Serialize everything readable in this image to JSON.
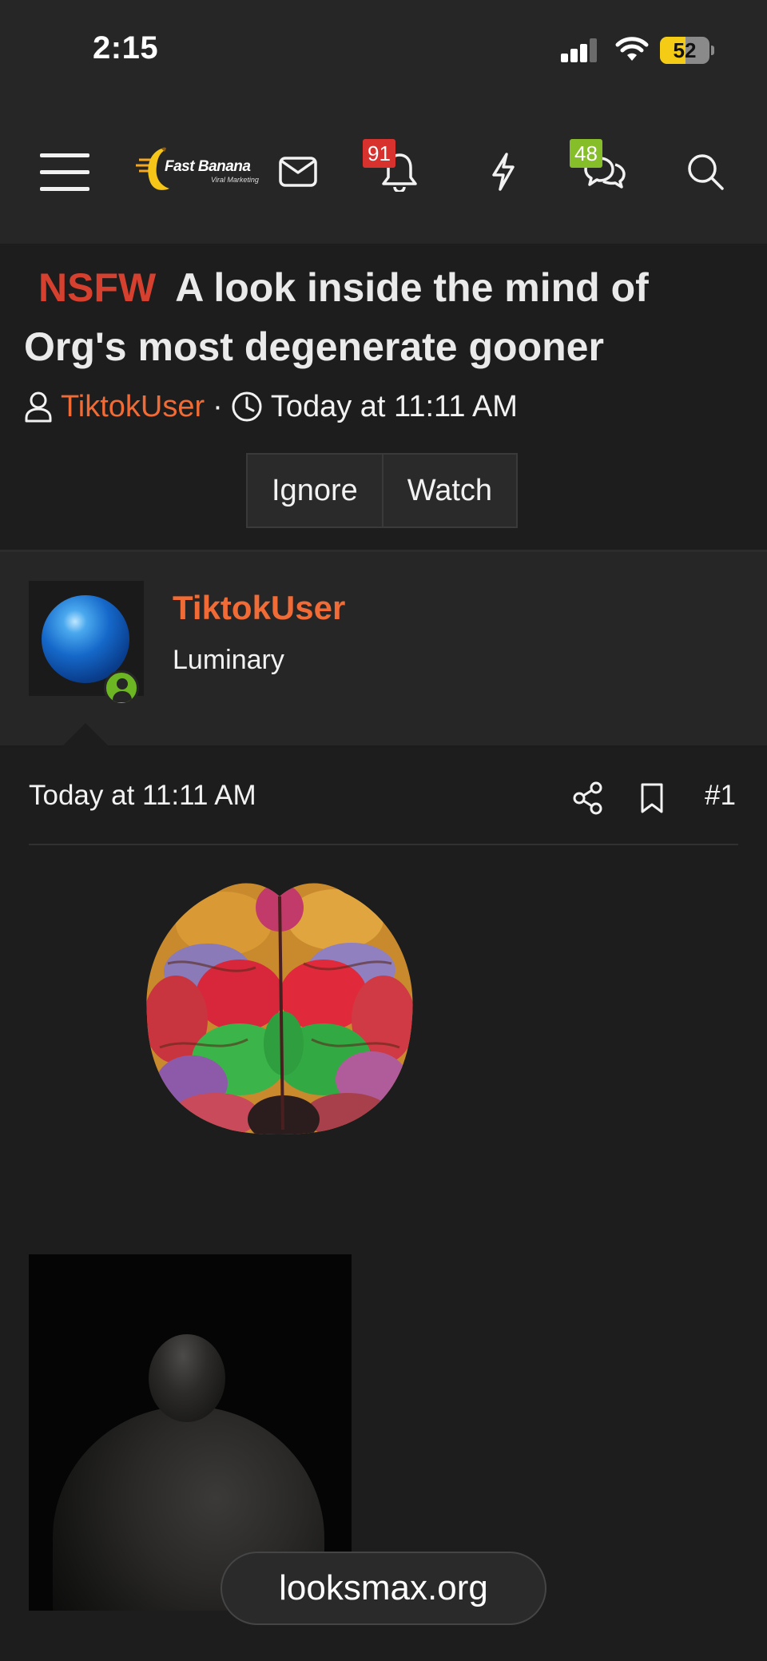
{
  "status_bar": {
    "time": "2:15",
    "battery_level": "52",
    "battery_fraction": 0.52
  },
  "nav": {
    "logo_name": "Fast Banana",
    "logo_tagline": "Viral Marketing",
    "alerts_count": "91",
    "conversations_count": "48",
    "icons": [
      "menu-icon",
      "mail-icon",
      "bell-icon",
      "bolt-icon",
      "chat-icon",
      "search-icon"
    ],
    "colors": {
      "alerts_badge": "#d8322f",
      "conversations_badge": "#86be2a"
    }
  },
  "thread": {
    "prefix": "NSFW",
    "title": "A look inside the mind of Org's most degenerate gooner",
    "author": "TiktokUser",
    "separator": "·",
    "timestamp": "Today at 11:11 AM",
    "ignore_label": "Ignore",
    "watch_label": "Watch"
  },
  "post": {
    "username": "TiktokUser",
    "user_title": "Luminary",
    "date": "Today at 11:11 AM",
    "post_number": "#1",
    "accent_color": "#f06b35"
  },
  "browser": {
    "url": "looksmax.org"
  }
}
